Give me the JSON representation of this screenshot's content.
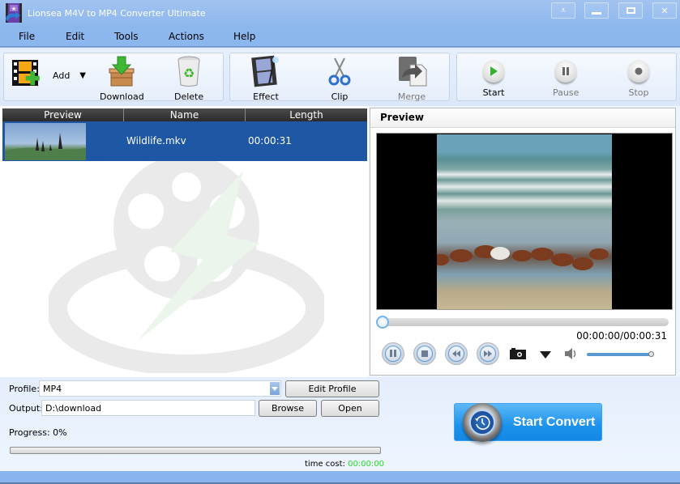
{
  "window": {
    "title": "Lionsea M4V to MP4 Converter Ultimate",
    "controls": [
      "dropdown-menu",
      "minimize",
      "maximize",
      "close"
    ]
  },
  "menu": {
    "items": [
      {
        "label": "File"
      },
      {
        "label": "Edit"
      },
      {
        "label": "Tools"
      },
      {
        "label": "Actions"
      },
      {
        "label": "Help"
      }
    ]
  },
  "toolbar": {
    "add": {
      "label": "Add",
      "icon": "film-add-icon"
    },
    "download": {
      "label": "Download",
      "icon": "download-box-icon"
    },
    "delete": {
      "label": "Delete",
      "icon": "recycle-bin-icon"
    },
    "effect": {
      "label": "Effect",
      "icon": "film-effect-icon"
    },
    "clip": {
      "label": "Clip",
      "icon": "scissors-icon"
    },
    "merge": {
      "label": "Merge",
      "icon": "merge-icon",
      "enabled": false
    },
    "start": {
      "label": "Start",
      "icon": "play-icon"
    },
    "pause": {
      "label": "Pause",
      "icon": "pause-icon",
      "enabled": false
    },
    "stop": {
      "label": "Stop",
      "icon": "stop-icon",
      "enabled": false
    }
  },
  "file_list": {
    "columns": [
      "Preview",
      "Name",
      "Length"
    ],
    "rows": [
      {
        "name": "Wildlife.mkv",
        "length": "00:00:31",
        "selected": true
      }
    ]
  },
  "preview": {
    "title": "Preview",
    "time": "00:00:00/00:00:31",
    "seek_fraction": 0,
    "volume_fraction": 1.0
  },
  "settings": {
    "profile_label": "Profile:",
    "profile_value": "MP4",
    "edit_profile_label": "Edit Profile",
    "output_label": "Output:",
    "output_value": "D:\\download",
    "browse_label": "Browse",
    "open_label": "Open",
    "progress_label": "Progress: 0%",
    "progress_fraction": 0,
    "time_cost_label": "time cost:",
    "time_cost_value": "00:00:00"
  },
  "convert": {
    "label": "Start Convert"
  },
  "colors": {
    "selection": "#1e57a4",
    "titlebar": "#8cb7ee",
    "time_cost_value": "#22e022",
    "convert_button": "#1b92ec"
  }
}
